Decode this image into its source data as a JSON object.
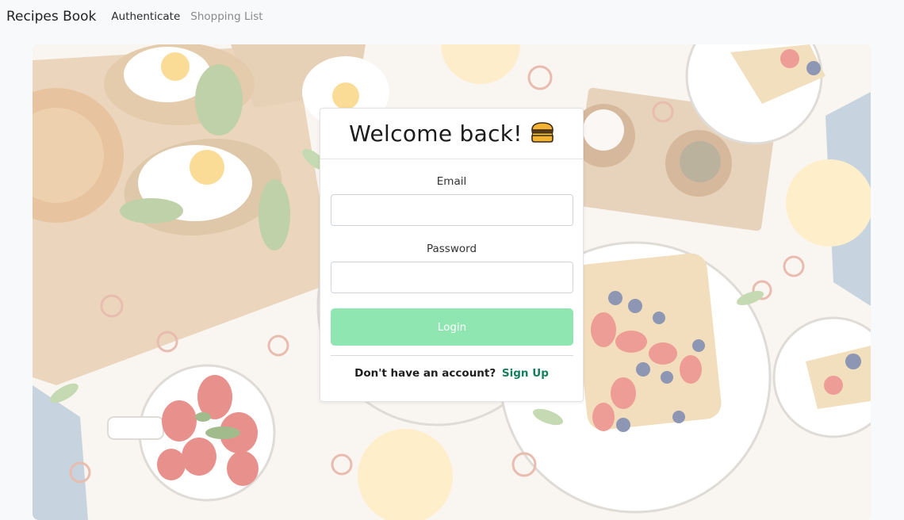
{
  "navbar": {
    "brand": "Recipes Book",
    "links": [
      {
        "label": "Authenticate",
        "active": true
      },
      {
        "label": "Shopping List",
        "active": false
      }
    ]
  },
  "login_card": {
    "title": "Welcome back!",
    "title_icon": "burger-icon",
    "email_label": "Email",
    "email_value": "",
    "password_label": "Password",
    "password_value": "",
    "login_button": "Login",
    "signup_prompt": "Don't have an account?",
    "signup_link": "Sign Up"
  },
  "colors": {
    "login_button": "#8fe6b0",
    "signup_link": "#157f5f"
  }
}
